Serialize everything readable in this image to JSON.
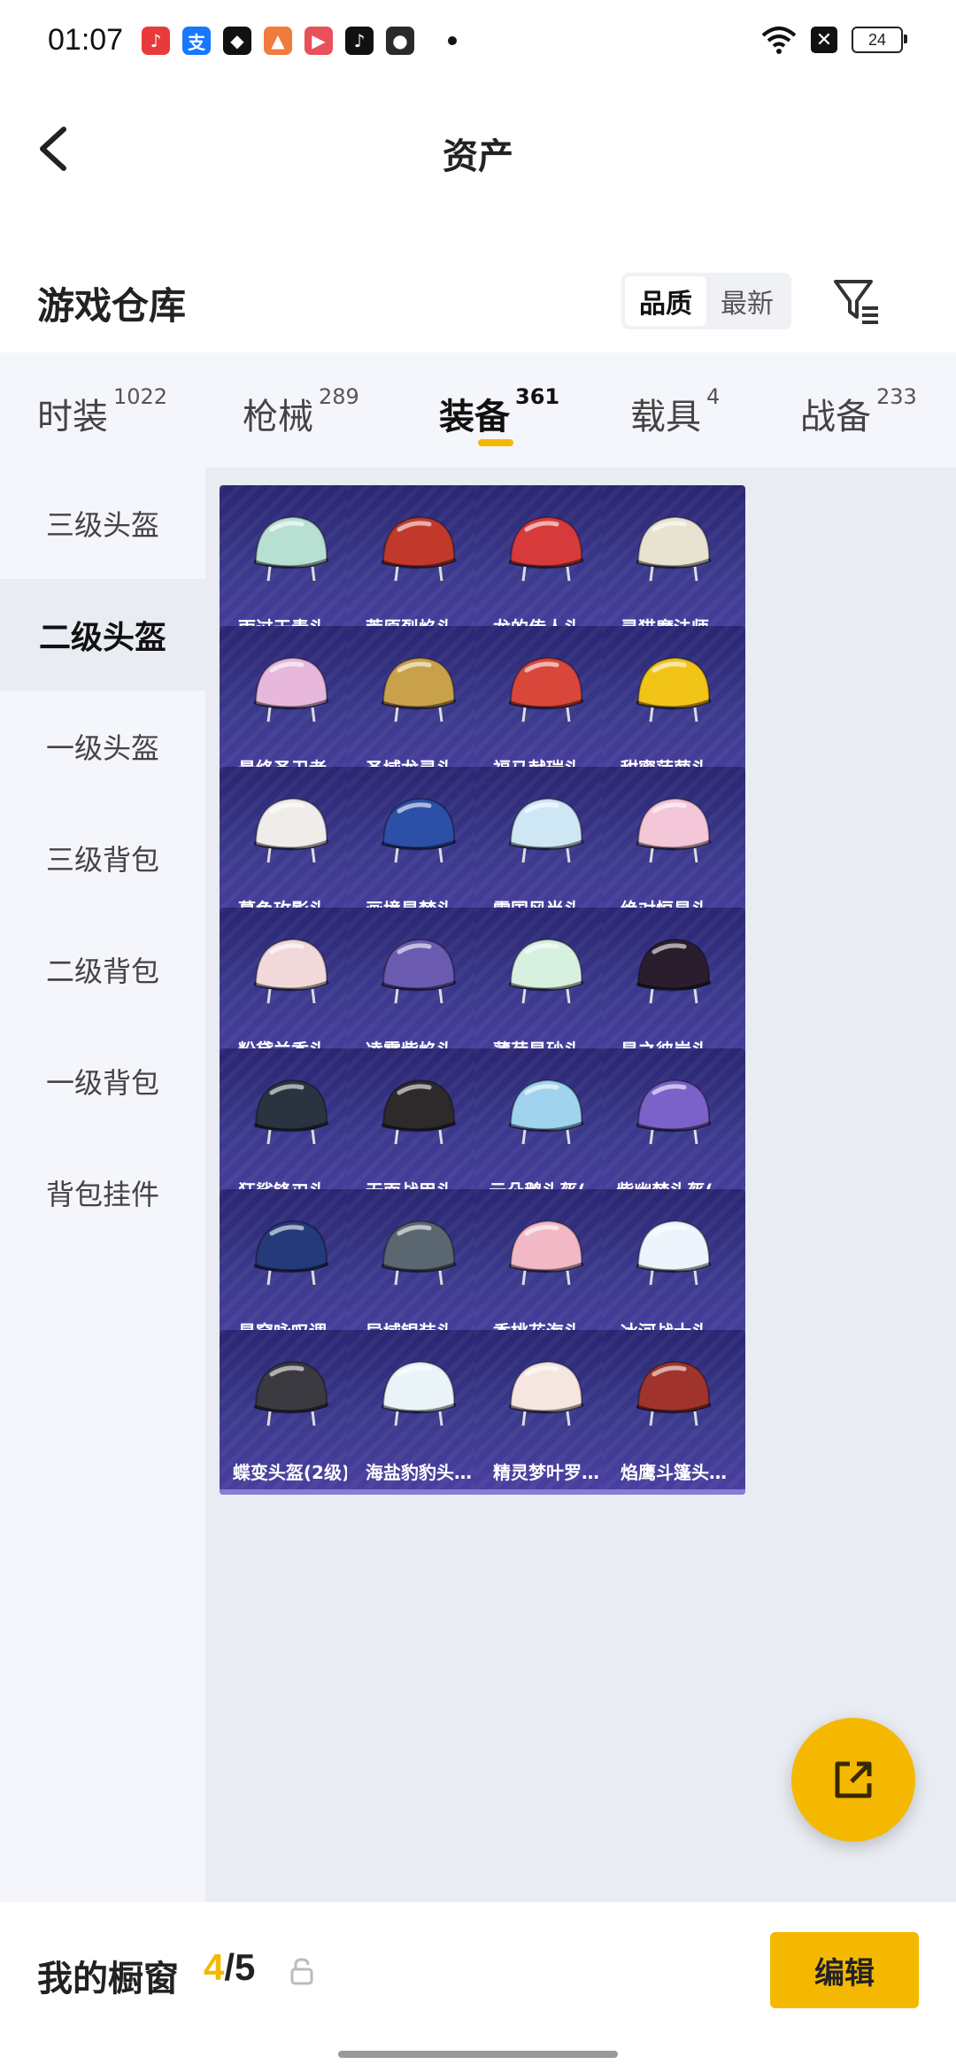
{
  "status": {
    "time": "01:07",
    "battery": "24",
    "apps": [
      {
        "icon": "music-app-icon",
        "color": "#e83a3a",
        "glyph": "♪"
      },
      {
        "icon": "alipay-icon",
        "color": "#1677ff",
        "glyph": "支"
      },
      {
        "icon": "shield-app-icon",
        "color": "#111111",
        "glyph": "◆"
      },
      {
        "icon": "orange-app-icon",
        "color": "#f07b3f",
        "glyph": "▲"
      },
      {
        "icon": "video-app-icon",
        "color": "#e8505b",
        "glyph": "▶"
      },
      {
        "icon": "douyin-icon",
        "color": "#111111",
        "glyph": "♪"
      },
      {
        "icon": "wechat-icon",
        "color": "#2a2a2a",
        "glyph": "●"
      }
    ]
  },
  "header": {
    "title": "资产"
  },
  "section": {
    "title": "游戏仓库",
    "sort_options": [
      "品质",
      "最新"
    ]
  },
  "tabs": [
    {
      "label": "时装",
      "count": "1022"
    },
    {
      "label": "枪械",
      "count": "289"
    },
    {
      "label": "装备",
      "count": "361"
    },
    {
      "label": "载具",
      "count": "4"
    },
    {
      "label": "战备",
      "count": "233"
    }
  ],
  "sidebar": [
    {
      "label": "三级头盔"
    },
    {
      "label": "二级头盔"
    },
    {
      "label": "一级头盔"
    },
    {
      "label": "三级背包"
    },
    {
      "label": "二级背包"
    },
    {
      "label": "一级背包"
    },
    {
      "label": "背包挂件"
    }
  ],
  "items": [
    {
      "name": "雨过天青头…",
      "color": "#b8e0d2"
    },
    {
      "name": "荒原烈焰头…",
      "color": "#c0392b"
    },
    {
      "name": "龙的传人头…",
      "color": "#d63a3a"
    },
    {
      "name": "灵猫魔法师…",
      "color": "#e8e2d0"
    },
    {
      "name": "最终圣卫者…",
      "color": "#e7b8dc"
    },
    {
      "name": "圣域龙灵头…",
      "color": "#c9a14a"
    },
    {
      "name": "福马献瑞头…",
      "color": "#d9463a"
    },
    {
      "name": "甜蜜菠萝头…",
      "color": "#f2c418"
    },
    {
      "name": "暮色玫影头…",
      "color": "#f0ecea"
    },
    {
      "name": "画境星梦头…",
      "color": "#2c4fa8"
    },
    {
      "name": "雪国风尚头…",
      "color": "#cfe6f5"
    },
    {
      "name": "绝对恒星头…",
      "color": "#f3c6d8"
    },
    {
      "name": "粉黛兰香头…",
      "color": "#f1d9db"
    },
    {
      "name": "凌霄紫焰头…",
      "color": "#6b5bb0"
    },
    {
      "name": "薄荷星砂头…",
      "color": "#d7f0e0"
    },
    {
      "name": "星之彼岸头…",
      "color": "#2a1e2e"
    },
    {
      "name": "狂鲨锋刃头…",
      "color": "#2a3440"
    },
    {
      "name": "无面战甲头…",
      "color": "#2e2a2c"
    },
    {
      "name": "云朵鹅头盔(…",
      "color": "#9fd3ee"
    },
    {
      "name": "紫幽梦头盔(…",
      "color": "#7b62c8"
    },
    {
      "name": "星穹咏叹调…",
      "color": "#243a7a"
    },
    {
      "name": "异域银装头…",
      "color": "#5a6670"
    },
    {
      "name": "香桃花海头…",
      "color": "#f2b8c6"
    },
    {
      "name": "冰河战士头…",
      "color": "#eef4fb"
    },
    {
      "name": "蝶变头盔(2级)",
      "color": "#3a3a40"
    },
    {
      "name": "海盐豹豹头…",
      "color": "#eaf3f8"
    },
    {
      "name": "精灵梦叶罗…",
      "color": "#f6e6e0"
    },
    {
      "name": "焰鹰斗篷头…",
      "color": "#a0342c"
    }
  ],
  "bottom": {
    "label": "我的橱窗",
    "current": "4",
    "total": "/5",
    "edit_label": "编辑"
  },
  "colors": {
    "accent": "#f5b800",
    "card": "#3c3a8e"
  }
}
